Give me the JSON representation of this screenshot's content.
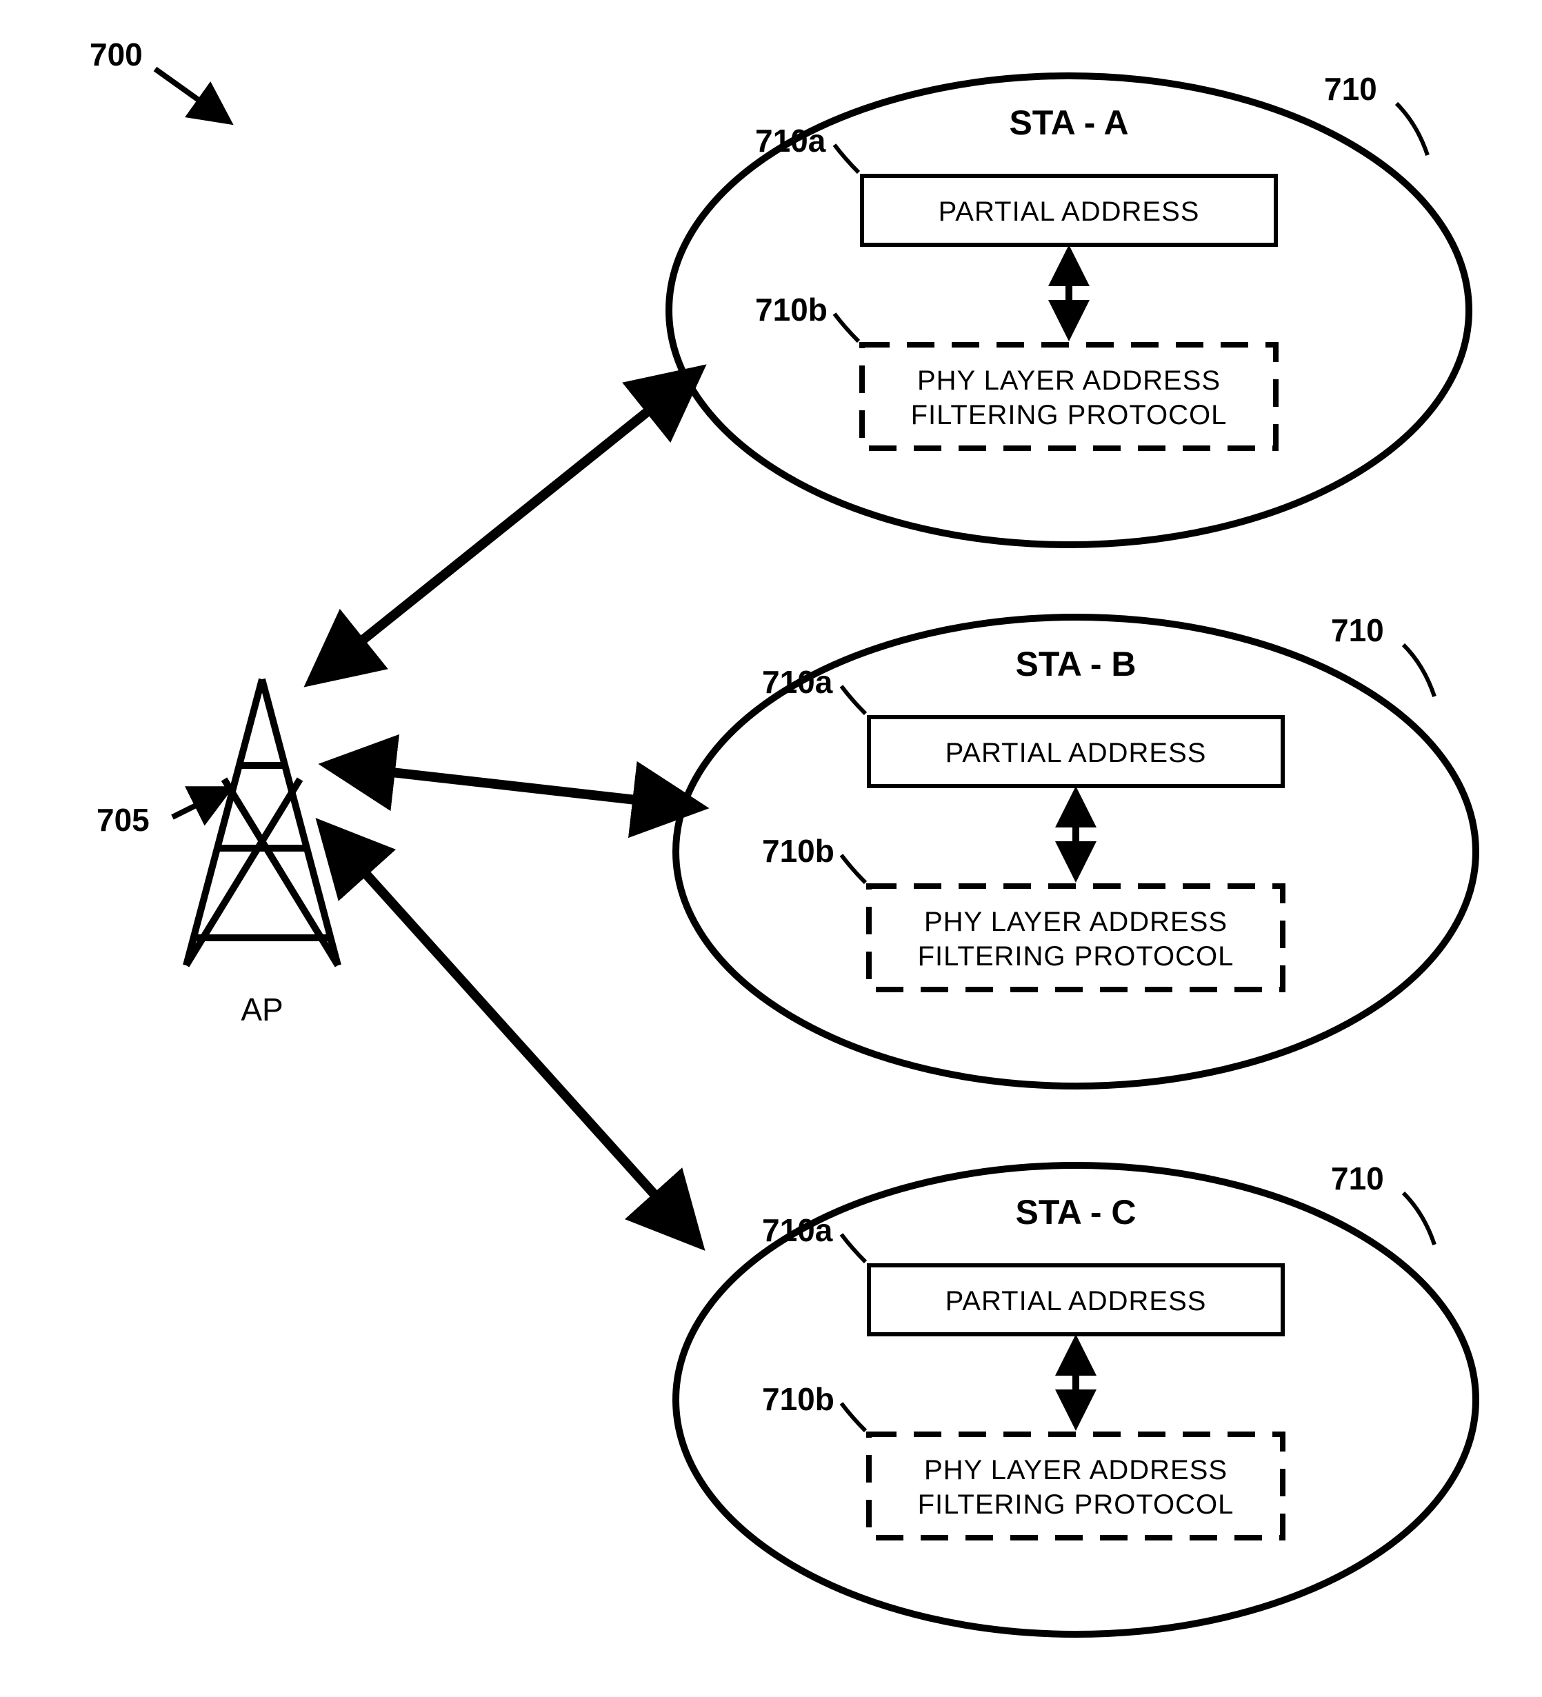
{
  "figure_ref": "700",
  "ap": {
    "ref": "705",
    "label": "AP"
  },
  "stations": [
    {
      "name": "STA - A",
      "ref": "710",
      "partial_ref": "710a",
      "partial_label": "PARTIAL ADDRESS",
      "filter_ref": "710b",
      "filter_line1": "PHY LAYER ADDRESS",
      "filter_line2": "FILTERING PROTOCOL"
    },
    {
      "name": "STA - B",
      "ref": "710",
      "partial_ref": "710a",
      "partial_label": "PARTIAL ADDRESS",
      "filter_ref": "710b",
      "filter_line1": "PHY LAYER ADDRESS",
      "filter_line2": "FILTERING PROTOCOL"
    },
    {
      "name": "STA - C",
      "ref": "710",
      "partial_ref": "710a",
      "partial_label": "PARTIAL ADDRESS",
      "filter_ref": "710b",
      "filter_line1": "PHY LAYER ADDRESS",
      "filter_line2": "FILTERING PROTOCOL"
    }
  ]
}
